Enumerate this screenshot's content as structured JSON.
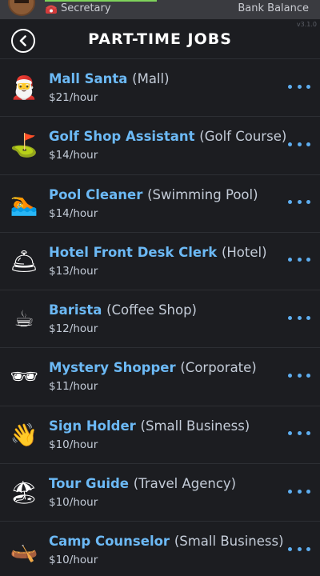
{
  "status_bar": {
    "occupation": "Secretary",
    "bank_label": "Bank Balance",
    "version": "v3.1.0"
  },
  "header": {
    "title": "PART-TIME JOBS"
  },
  "jobs": [
    {
      "icon": "santa-icon",
      "glyph": "🎅",
      "title": "Mall Santa",
      "location": "(Mall)",
      "wage": "$21/hour"
    },
    {
      "icon": "golf-flag-icon",
      "glyph": "⛳",
      "title": "Golf Shop Assistant",
      "location": "(Golf Course)",
      "wage": "$14/hour"
    },
    {
      "icon": "swimmer-icon",
      "glyph": "🏊",
      "title": "Pool Cleaner",
      "location": "(Swimming Pool)",
      "wage": "$14/hour"
    },
    {
      "icon": "bellhop-bell-icon",
      "glyph": "🛎",
      "title": "Hotel Front Desk Clerk",
      "location": "(Hotel)",
      "wage": "$13/hour"
    },
    {
      "icon": "coffee-cup-icon",
      "glyph": "☕",
      "title": "Barista",
      "location": "(Coffee Shop)",
      "wage": "$12/hour"
    },
    {
      "icon": "sunglasses-icon",
      "glyph": "🕶",
      "title": "Mystery Shopper",
      "location": "(Corporate)",
      "wage": "$11/hour"
    },
    {
      "icon": "waving-hand-icon",
      "glyph": "👋",
      "title": "Sign Holder",
      "location": "(Small Business)",
      "wage": "$10/hour"
    },
    {
      "icon": "beach-umbrella-icon",
      "glyph": "🏖",
      "title": "Tour Guide",
      "location": "(Travel Agency)",
      "wage": "$10/hour"
    },
    {
      "icon": "canoe-icon",
      "glyph": "🛶",
      "title": "Camp Counselor",
      "location": "(Small Business)",
      "wage": "$10/hour"
    }
  ],
  "colors": {
    "background": "#1c1d21",
    "job_title": "#6cb9f5",
    "more_dots": "#5eaef0"
  }
}
